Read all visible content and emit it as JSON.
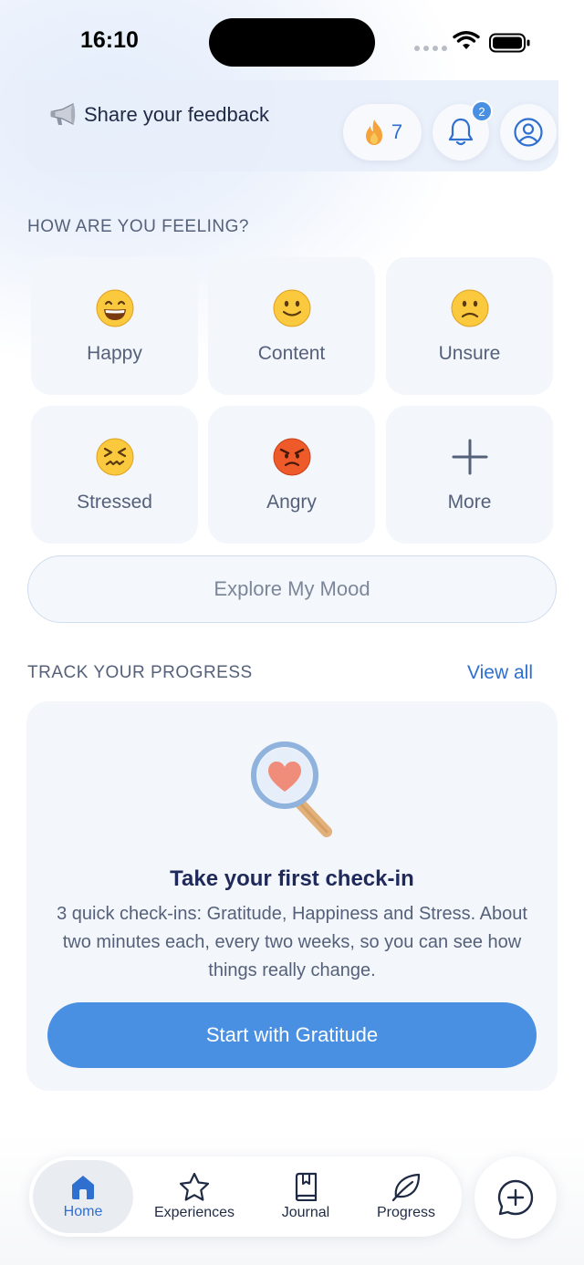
{
  "status_bar": {
    "time": "16:10"
  },
  "header": {
    "feedback_label": "Share your feedback",
    "streak_count": "7",
    "notification_count": "2"
  },
  "mood_section": {
    "title": "HOW ARE YOU FEELING?",
    "moods": [
      {
        "label": "Happy",
        "icon": "grinning-face-icon"
      },
      {
        "label": "Content",
        "icon": "slightly-smiling-face-icon"
      },
      {
        "label": "Unsure",
        "icon": "slightly-frowning-face-icon"
      },
      {
        "label": "Stressed",
        "icon": "confounded-face-icon"
      },
      {
        "label": "Angry",
        "icon": "angry-face-icon"
      },
      {
        "label": "More",
        "icon": "plus-icon"
      }
    ],
    "explore_label": "Explore My Mood"
  },
  "progress_section": {
    "title": "TRACK YOUR PROGRESS",
    "view_all_label": "View all",
    "card_title": "Take your first check-in",
    "card_body": "3 quick check-ins: Gratitude, Happiness and Stress. About two minutes each, every two weeks, so you can see how things really change.",
    "button_label": "Start with Gratitude"
  },
  "tab_bar": {
    "tabs": [
      {
        "label": "Home",
        "icon": "home-icon",
        "active": true
      },
      {
        "label": "Experiences",
        "icon": "star-icon",
        "active": false
      },
      {
        "label": "Journal",
        "icon": "journal-icon",
        "active": false
      },
      {
        "label": "Progress",
        "icon": "leaf-icon",
        "active": false
      }
    ]
  },
  "colors": {
    "accent": "#4a90e2",
    "link": "#2f6fd0",
    "tile_background": "#f3f6fb",
    "text_primary": "#1f2a44",
    "text_secondary": "#55617a"
  }
}
